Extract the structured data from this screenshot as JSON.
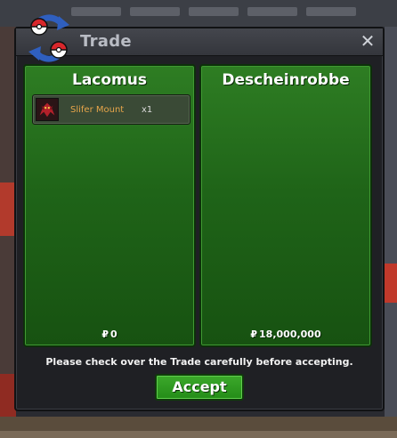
{
  "window": {
    "title": "Trade",
    "close_label": "✕"
  },
  "left_panel": {
    "player_name": "Lacomus",
    "items": [
      {
        "name": "Slifer Mount",
        "quantity": "x1",
        "icon": "slifer-mount-icon"
      }
    ],
    "currency_symbol": "₽",
    "money": "0"
  },
  "right_panel": {
    "player_name": "Descheinrobbe",
    "items": [],
    "currency_symbol": "₽",
    "money": "18,000,000"
  },
  "notice": "Please check over the Trade carefully before accepting.",
  "accept_label": "Accept",
  "colors": {
    "panel_green": "#1f6418",
    "button_green": "#2f9a22",
    "item_name": "#e7a54a",
    "window_bg": "#1f2024"
  }
}
